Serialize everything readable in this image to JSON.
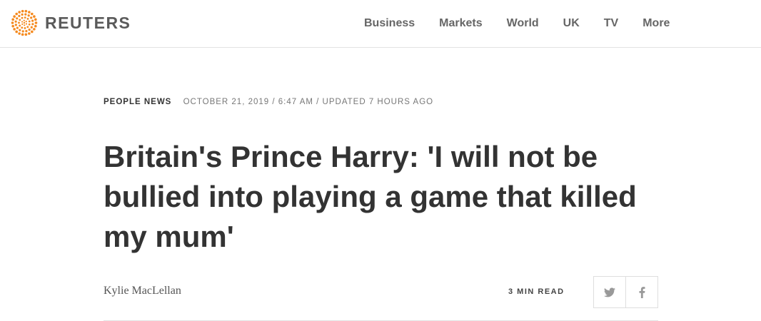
{
  "brand": {
    "name": "REUTERS",
    "accent_color": "#f58a1f"
  },
  "nav": {
    "items": [
      "Business",
      "Markets",
      "World",
      "UK",
      "TV",
      "More"
    ]
  },
  "article": {
    "section": "PEOPLE NEWS",
    "dateline": "OCTOBER 21, 2019 / 6:47 AM / UPDATED 7 HOURS AGO",
    "headline": "Britain's Prince Harry: 'I will not be bullied into playing a game that killed my mum'",
    "author": "Kylie MacLellan",
    "read_time": "3 MIN READ"
  },
  "share": {
    "twitter_icon": "twitter-icon",
    "facebook_icon": "facebook-icon"
  }
}
